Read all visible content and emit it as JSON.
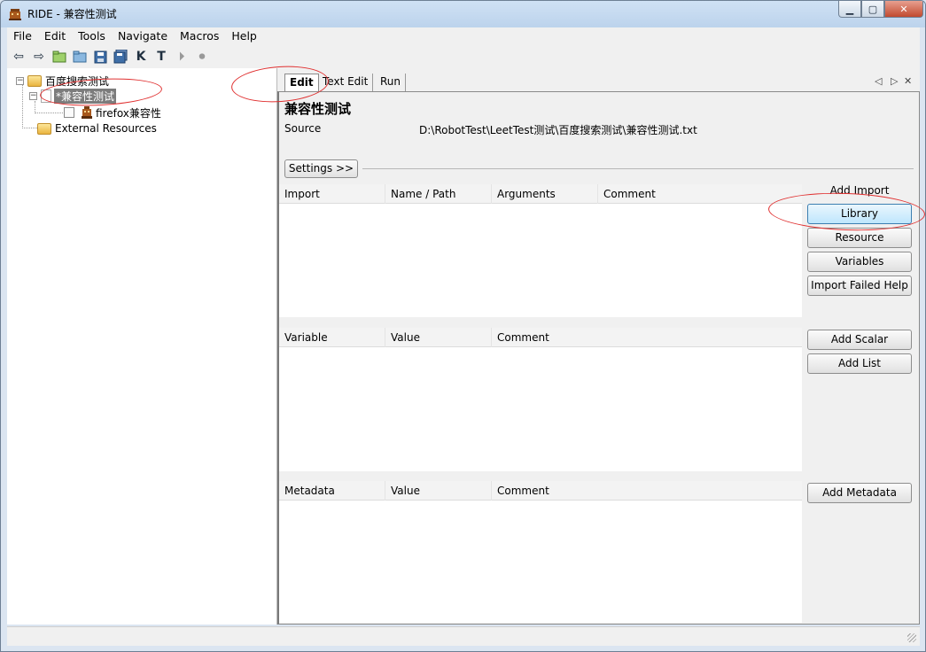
{
  "window": {
    "title": "RIDE - 兼容性测试",
    "minimize_glyph": "▁",
    "maximize_glyph": "▢",
    "close_glyph": "✕"
  },
  "menu": [
    "File",
    "Edit",
    "Tools",
    "Navigate",
    "Macros",
    "Help"
  ],
  "toolbar": {
    "icons": [
      "back-icon",
      "forward-icon",
      "open-folder-icon",
      "open-directory-icon",
      "save-icon",
      "save-all-icon",
      "search-keywords-icon",
      "search-tests-icon",
      "run-icon",
      "stop-icon"
    ],
    "glyphs": {
      "back": "⇦",
      "forward": "⇨",
      "open_folder": "📂",
      "open_dir": "🗁",
      "save": "▣",
      "save_all": "▤",
      "k": "K",
      "t": "T",
      "run": "⏵",
      "stop": "⏺"
    }
  },
  "tree": {
    "root": {
      "label": "百度搜索测试",
      "expander": "−"
    },
    "suite": {
      "label": "*兼容性测试",
      "expander": "−"
    },
    "test": {
      "label": "firefox兼容性"
    },
    "external": {
      "label": "External Resources"
    }
  },
  "tabs": [
    {
      "label": "Edit",
      "active": true
    },
    {
      "label": "Text Edit",
      "active": false
    },
    {
      "label": "Run",
      "active": false
    }
  ],
  "tab_nav": {
    "left": "◁",
    "right": "▷",
    "close": "✕"
  },
  "editor": {
    "title": "兼容性测试",
    "source_label": "Source",
    "source_value": "D:\\RobotTest\\LeetTest测试\\百度搜索测试\\兼容性测试.txt",
    "settings_button": "Settings >>"
  },
  "import_grid": {
    "headers": [
      "Import",
      "Name / Path",
      "Arguments",
      "Comment"
    ],
    "add_label": "Add Import",
    "buttons": [
      "Library",
      "Resource",
      "Variables",
      "Import Failed Help"
    ]
  },
  "variable_grid": {
    "headers": [
      "Variable",
      "Value",
      "Comment"
    ],
    "buttons": [
      "Add Scalar",
      "Add List"
    ]
  },
  "metadata_grid": {
    "headers": [
      "Metadata",
      "Value",
      "Comment"
    ],
    "buttons": [
      "Add Metadata"
    ]
  },
  "colors": {
    "annotation": "#e03030",
    "selection": "#7c7c7c",
    "focus_button": "#bee6fd"
  }
}
